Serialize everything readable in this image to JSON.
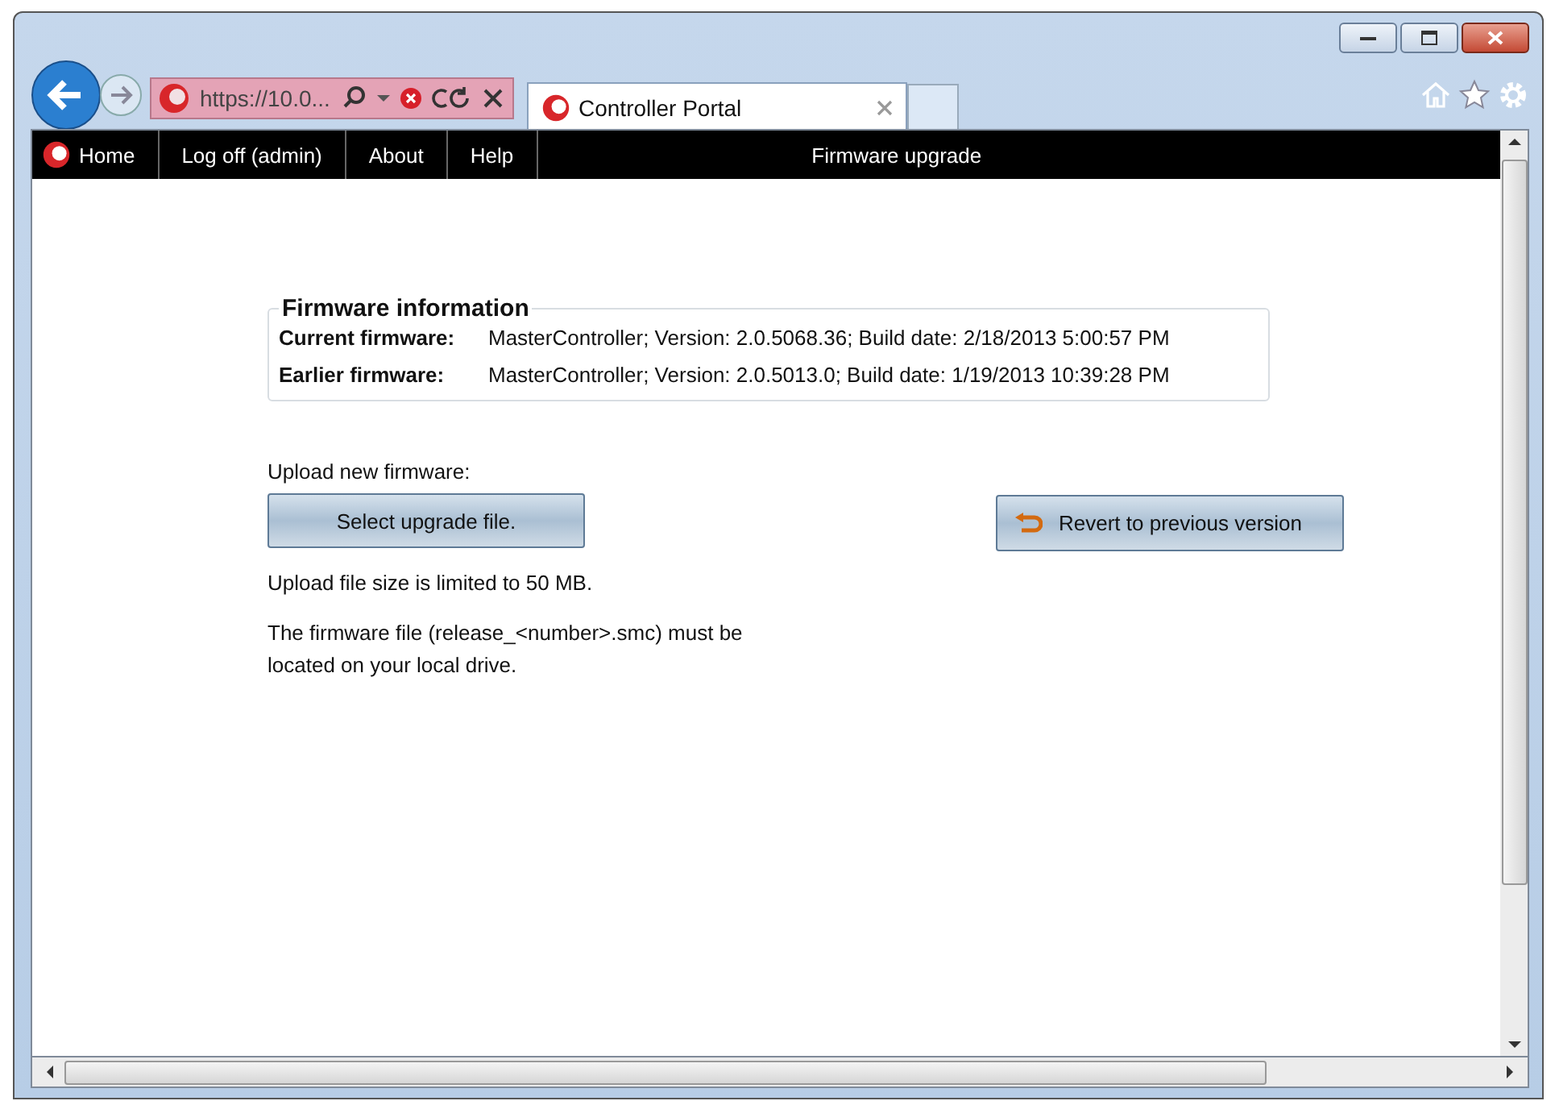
{
  "address_bar": {
    "url": "https://10.0..."
  },
  "tabs": [
    {
      "label": "Controller Portal",
      "selected": true
    }
  ],
  "nav": {
    "items": [
      {
        "label": "Home",
        "kind": "logo"
      },
      {
        "label": "Log off (admin)",
        "kind": "plain"
      },
      {
        "label": "About",
        "kind": "plain"
      },
      {
        "label": "Help",
        "kind": "plain"
      }
    ],
    "page_title": "Firmware upgrade"
  },
  "firmware_info": {
    "title": "Firmware information",
    "rows": [
      {
        "label": "Current firmware:",
        "value": "MasterController; Version: 2.0.5068.36; Build date: 2/18/2013 5:00:57 PM"
      },
      {
        "label": "Earlier firmware:",
        "value": "MasterController; Version: 2.0.5013.0; Build date: 1/19/2013 10:39:28 PM"
      }
    ]
  },
  "upload": {
    "label": "Upload new firmware:",
    "select_button": "Select upgrade file.",
    "revert_button": "Revert to previous version",
    "notes": [
      "Upload file size is limited to 50 MB.",
      "The firmware file (release_<number>.smc) must be located on your local drive."
    ]
  }
}
